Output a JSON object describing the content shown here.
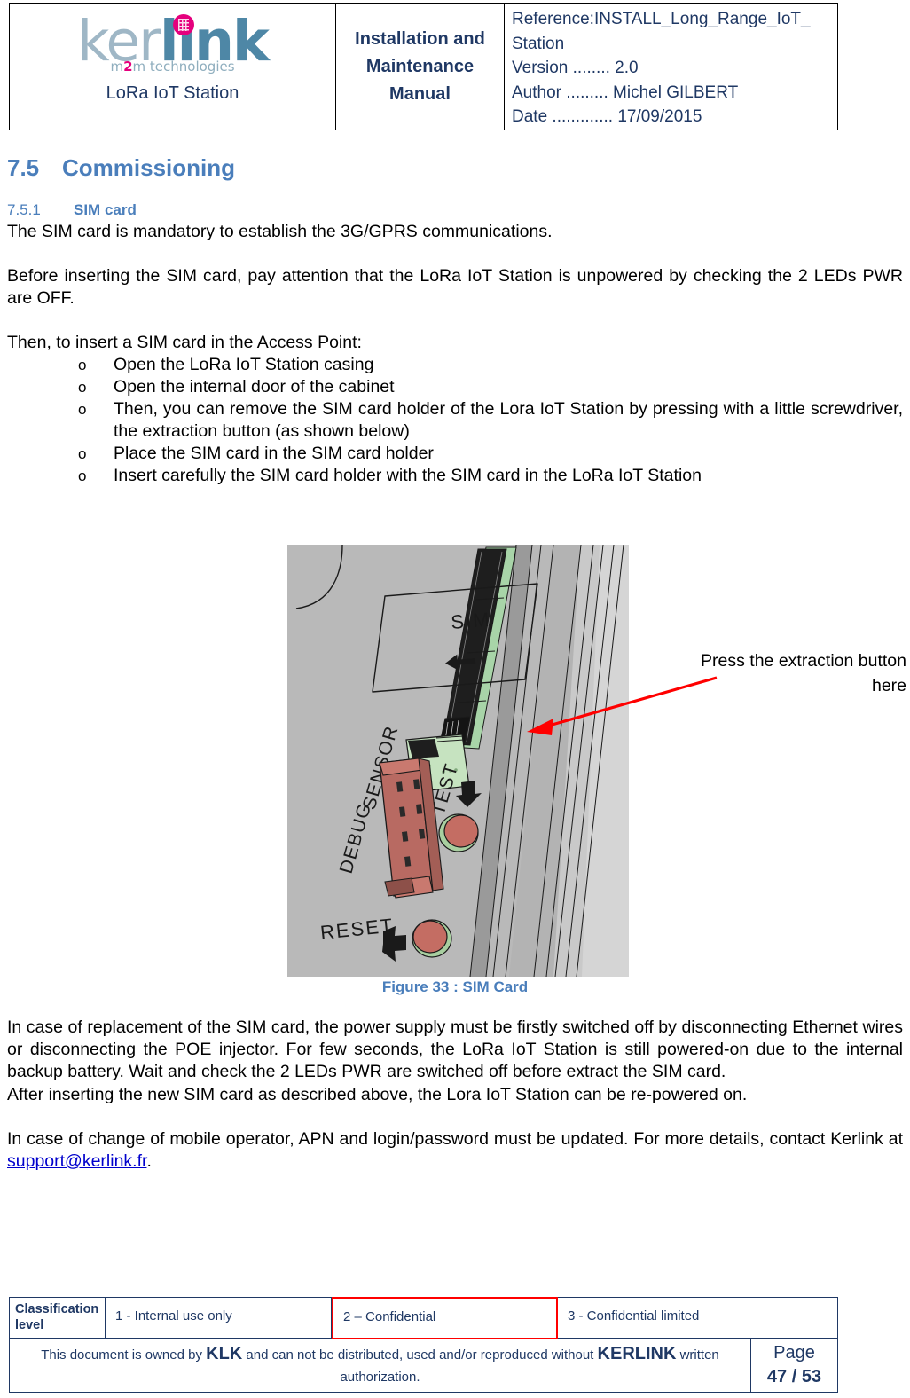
{
  "header": {
    "logo": {
      "part1": "ker",
      "part2": "link",
      "tagline_pre": "m",
      "tagline_mid": "2",
      "tagline_post": "m technologies",
      "subtitle": "LoRa IoT Station"
    },
    "doc_type": "Installation and Maintenance Manual",
    "meta": [
      "Reference:INSTALL_Long_Range_IoT_",
      "Station",
      "Version ........ 2.0",
      "Author ......... Michel GILBERT",
      "Date ............. 17/09/2015"
    ]
  },
  "section": {
    "number": "7.5",
    "title": "Commissioning"
  },
  "subsection": {
    "number": "7.5.1",
    "title": "SIM card"
  },
  "paragraphs": {
    "p1": "The SIM card is mandatory to establish the 3G/GPRS communications.",
    "p2": "Before inserting the SIM card, pay attention that the LoRa IoT Station is unpowered by checking the 2 LEDs PWR are OFF.",
    "p3": "Then, to insert a SIM card in the Access Point:",
    "p4": "In case of replacement of the SIM card, the power supply must be firstly switched off by disconnecting Ethernet wires or disconnecting the POE injector. For few seconds, the LoRa IoT Station is still powered-on due to the internal backup battery.  Wait and check the 2 LEDs PWR are switched off before extract the SIM card.",
    "p5": "After inserting the new SIM card as described above, the Lora IoT Station can be re-powered on.",
    "p6_before": "In case of change of mobile operator, APN and login/password must be updated. For more details, contact Kerlink at ",
    "p6_link": "support@kerlink.fr",
    "p6_after": "."
  },
  "bullets": {
    "marker": "o",
    "items": [
      "Open the LoRa IoT Station casing",
      "Open the internal door of the cabinet",
      "Then, you can remove the SIM card holder of the Lora IoT Station by pressing with a little screwdriver, the extraction button (as shown below)",
      "Place the SIM card in the SIM card holder",
      "Insert carefully the SIM card holder with the SIM card in the LoRa IoT Station"
    ]
  },
  "figure": {
    "caption": "Figure 33 : SIM Card",
    "callout": "Press the extraction button here",
    "labels": {
      "sim": "SIM",
      "sensor": "SENSOR",
      "test": "TEST",
      "debug": "DEBUG",
      "reset": "RESET"
    }
  },
  "footer": {
    "classification_label": "Classification level",
    "levels": [
      "1 - Internal use only",
      "2 – Confidential",
      "3 - Confidential limited"
    ],
    "notice_a": "This document is owned by ",
    "notice_klk": "KLK",
    "notice_b": " and can not be distributed, used and/or reproduced  without ",
    "notice_kerlink": "KERLINK",
    "notice_c": " written authorization.",
    "page_label": "Page",
    "page_value": "47 / 53"
  },
  "colors": {
    "heading_blue": "#4A7EBB",
    "navy": "#1F3864",
    "link_blue": "#0000CC",
    "accent_pink": "#E5007D",
    "logo_blue": "#4E87A6",
    "red_highlight": "#FF0000"
  }
}
